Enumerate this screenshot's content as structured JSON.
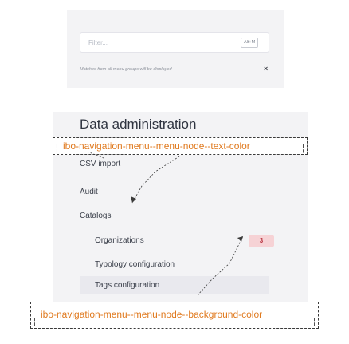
{
  "filter": {
    "placeholder": "Filter...",
    "shortcut": "Alt+M",
    "hint": "Matches from all menu groups will be displayed",
    "clear_symbol": "×"
  },
  "menu_group": {
    "title": "Data administration",
    "items": [
      {
        "label": "CSV import"
      },
      {
        "label": "Audit"
      },
      {
        "label": "Catalogs"
      }
    ],
    "catalog_items": [
      {
        "label": "Organizations",
        "count": "3"
      },
      {
        "label": "Typology configuration"
      },
      {
        "label": "Tags configuration"
      }
    ]
  },
  "annotations": {
    "text_color": "ibo-navigation-menu--menu-node--text-color",
    "background_color": "ibo-navigation-menu--menu-node--background-color"
  },
  "colors": {
    "annotation_text": "#e07a1f",
    "panel_background": "#f3f3f5",
    "badge_background": "#f6d2d5",
    "badge_text": "#b7323f"
  }
}
